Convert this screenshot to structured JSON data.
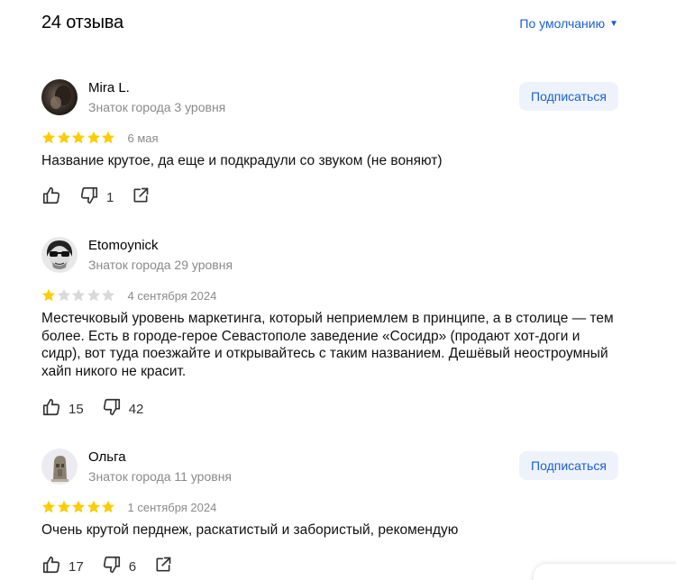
{
  "header": {
    "title": "24 отзыва",
    "sort_label": "По умолчанию"
  },
  "colors": {
    "accent": "#1a5fd6",
    "star": "#fc0",
    "star_empty": "#d9d9d9",
    "muted": "#8a8a8a"
  },
  "reviews": [
    {
      "author": "Mira L.",
      "level": "Знаток города 3 уровня",
      "subscribe_label": "Подписаться",
      "rating": 5,
      "date": "6 мая",
      "text": "Название крутое, да еще и подкрадули со звуком (не воняют)",
      "likes": "",
      "dislikes": "1",
      "has_share": true
    },
    {
      "author": "Etomoynick",
      "level": "Знаток города 29 уровня",
      "subscribe_label": "",
      "rating": 1,
      "date": "4 сентября 2024",
      "text": "Местечковый уровень маркетинга, который неприемлем в принципе, а в столице — тем более. Есть в городе-герое Севастополе заведение «Сосидр» (продают хот-доги и сидр), вот туда поезжайте и открывайтесь с таким названием. Дешёвый неостроумный хайп никого не красит.",
      "likes": "15",
      "dislikes": "42",
      "has_share": false
    },
    {
      "author": "Ольга",
      "level": "Знаток города 11 уровня",
      "subscribe_label": "Подписаться",
      "rating": 5,
      "date": "1 сентября 2024",
      "text": "Очень крутой перднеж, раскатистый и забористый, рекомендую",
      "likes": "17",
      "dislikes": "6",
      "has_share": true
    }
  ]
}
